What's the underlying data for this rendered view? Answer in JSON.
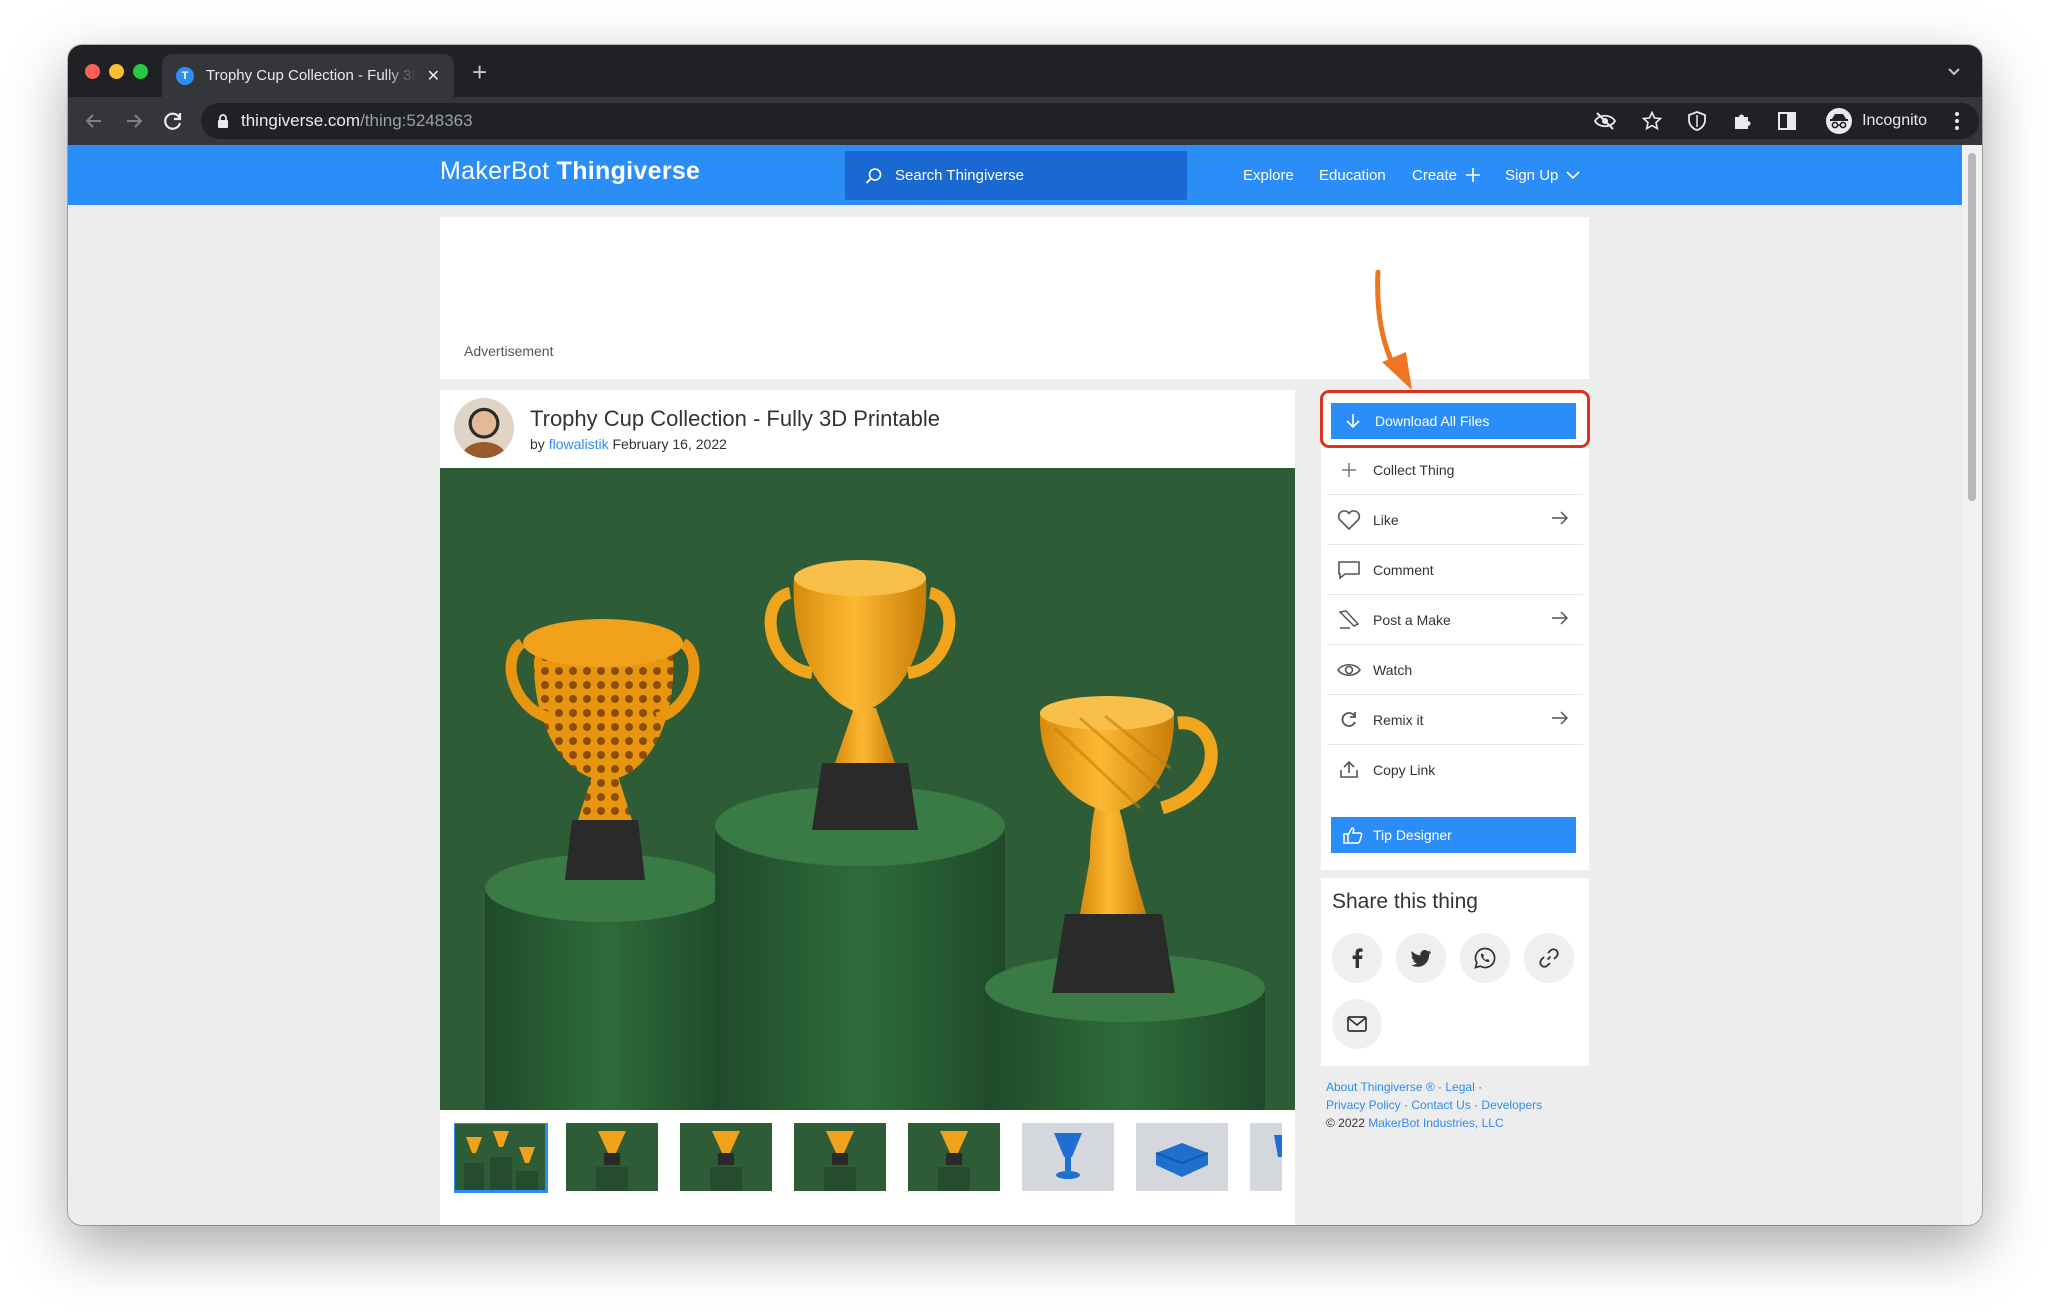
{
  "browser": {
    "tab_title": "Trophy Cup Collection - Fully 3D Printable",
    "favicon_letter": "T",
    "close_glyph": "✕",
    "newtab_glyph": "+",
    "url_host": "thingiverse.com",
    "url_path": "/thing:5248363",
    "profile_label": "Incognito"
  },
  "site": {
    "logo_maker": "MakerBot",
    "logo_thing": "Thingiverse",
    "search_placeholder": "Search Thingiverse",
    "nav": {
      "explore": "Explore",
      "education": "Education",
      "create": "Create",
      "signup": "Sign Up"
    },
    "brand_color": "#2b8df8"
  },
  "ad": {
    "label": "Advertisement"
  },
  "thing": {
    "title": "Trophy Cup Collection - Fully 3D Printable",
    "by": "by",
    "author": "flowalistik",
    "date": "February 16, 2022"
  },
  "sidebar": {
    "download_label": "Download All Files",
    "actions": [
      {
        "label": "Collect Thing",
        "icon": "plus-icon",
        "arrow": false
      },
      {
        "label": "Like",
        "icon": "heart-icon",
        "arrow": true
      },
      {
        "label": "Comment",
        "icon": "comment-icon",
        "arrow": false
      },
      {
        "label": "Post a Make",
        "icon": "make-icon",
        "arrow": true
      },
      {
        "label": "Watch",
        "icon": "eye-icon",
        "arrow": false
      },
      {
        "label": "Remix it",
        "icon": "remix-icon",
        "arrow": true
      },
      {
        "label": "Copy Link",
        "icon": "share-icon",
        "arrow": false
      }
    ],
    "tip_label": "Tip Designer"
  },
  "share": {
    "title": "Share this thing",
    "icons": [
      "facebook-icon",
      "twitter-icon",
      "whatsapp-icon",
      "link-icon",
      "email-icon"
    ]
  },
  "footer": {
    "about": "About Thingiverse ®",
    "legal": "Legal",
    "privacy": "Privacy Policy",
    "contact": "Contact Us",
    "developers": "Developers",
    "copyright": "© 2022",
    "company": "MakerBot Industries, LLC",
    "sep": "·"
  },
  "annotation": {
    "arrow_color": "#ee7623",
    "highlight_color": "#d9321f"
  }
}
